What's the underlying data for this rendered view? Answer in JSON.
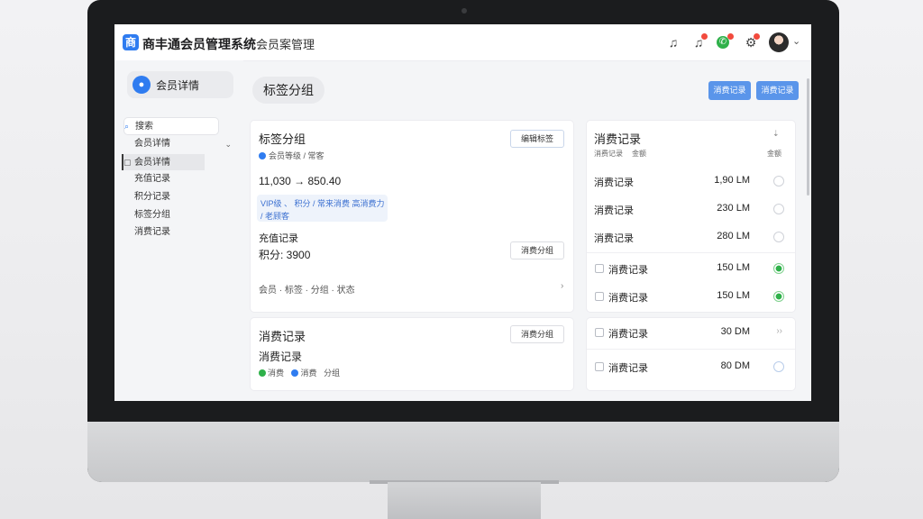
{
  "app": {
    "logo_glyph": "商",
    "title": "商丰通会员管理系统",
    "subtitle": "会员案管理",
    "accent_color": "#2f7cf0"
  },
  "topbar": {
    "icons": [
      "bell-icon",
      "notification-icon",
      "phone-icon",
      "cart-icon"
    ],
    "user_caret": "⌄"
  },
  "sidebar": {
    "profile_label": "会员详情",
    "items": [
      {
        "label": "搜索",
        "icon": "search-icon"
      },
      {
        "label": "会员详情",
        "icon": "",
        "caret": "⌄"
      },
      {
        "label": "会员详情",
        "icon": "folder-icon"
      },
      {
        "label": "充值记录",
        "icon": ""
      },
      {
        "label": "积分记录",
        "icon": ""
      },
      {
        "label": "标签分组",
        "icon": ""
      },
      {
        "label": "消费记录",
        "icon": ""
      }
    ]
  },
  "main": {
    "page_tab": "标签分组",
    "header_buttons": [
      "消费记录",
      "消费记录"
    ]
  },
  "card_tags": {
    "title": "标签分组",
    "button": "编辑标签",
    "meta": "会员等级 / 常客",
    "amount_line": "11,030 → 850.40",
    "chip_line1": "VIP级 、 积分 / 常来消费 高消费力",
    "chip_line2": "/ 老顾客",
    "section_label": "充值记录",
    "section_value": "积分: 3900",
    "section_button": "消费分组",
    "footer_text": "会员 · 标签 · 分组 · 状态",
    "footer_mark": "›"
  },
  "card_consume": {
    "title": "消费记录",
    "subtitle": "消费记录",
    "tags": [
      "消费",
      "消费",
      "分组"
    ],
    "button": "消费分组"
  },
  "records": {
    "title": "消费记录",
    "columns": [
      "消费记录",
      "金额"
    ],
    "right_header": "金额",
    "rows": [
      {
        "label": "消费记录",
        "amount": "1,90 LM",
        "checkbox": false,
        "radio": false
      },
      {
        "label": "消费记录",
        "amount": "230 LM",
        "checkbox": false,
        "radio": false
      },
      {
        "label": "消费记录",
        "amount": "280 LM",
        "checkbox": false,
        "radio": false
      },
      {
        "label": "消费记录",
        "amount": "150 LM",
        "checkbox": true,
        "radio": true
      },
      {
        "label": "消费记录",
        "amount": "150 LM",
        "checkbox": true,
        "radio": true
      }
    ],
    "rows2": [
      {
        "label": "消费记录",
        "amount": "30 DM",
        "icon": "chevron-right-icon"
      },
      {
        "label": "消费记录",
        "amount": "80 DM",
        "icon": "radio-icon"
      }
    ]
  }
}
